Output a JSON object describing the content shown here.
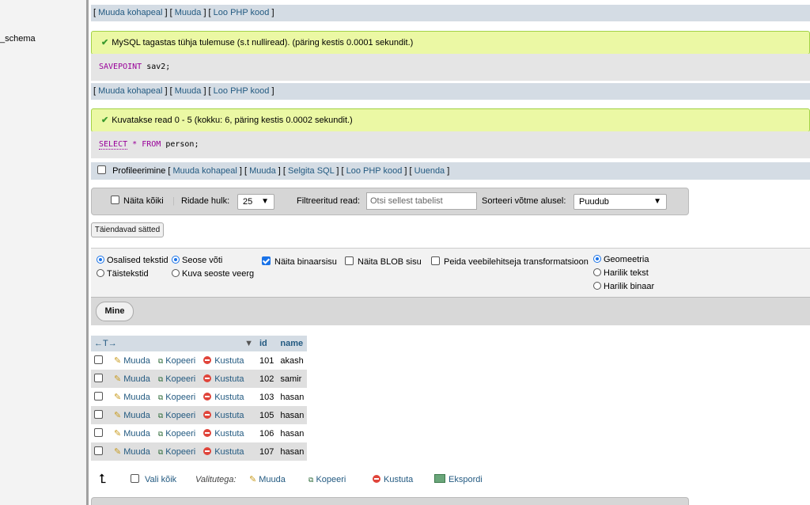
{
  "nav": {
    "items": [
      "",
      "_schema"
    ]
  },
  "top_links": {
    "edit_inline": "Muuda kohapeal",
    "edit": "Muuda",
    "create_php": "Loo PHP kood"
  },
  "message1": "MySQL tagastas tühja tulemuse (s.t nulliread). (päring kestis 0.0001 sekundit.)",
  "sql1": {
    "keyword": "SAVEPOINT",
    "rest": " sav2;"
  },
  "links2": {
    "edit_inline": "Muuda kohapeal",
    "edit": "Muuda",
    "create_php": "Loo PHP kood"
  },
  "message2": "Kuvatakse read 0 - 5 (kokku: 6, päring kestis 0.0002 sekundit.)",
  "sql2": {
    "select": "SELECT",
    "star": "*",
    "from": "FROM",
    "table": " person;"
  },
  "profile_bar": {
    "profiling": "Profileerimine",
    "edit_inline": "Muuda kohapeal",
    "edit": "Muuda",
    "explain": "Selgita SQL",
    "create_php": "Loo PHP kood",
    "refresh": "Uuenda"
  },
  "nav_controls": {
    "show_all": "Näita kõiki",
    "rows_label": "Ridade hulk:",
    "rows_value": "25",
    "filter_label": "Filtreeritud read:",
    "filter_placeholder": "Otsi sellest tabelist",
    "sort_label": "Sorteeri võtme alusel:",
    "sort_value": "Puudub"
  },
  "extra_options_button": "Täiendavad sätted",
  "options": {
    "partial_texts": "Osalised tekstid",
    "full_texts": "Täistekstid",
    "relational_key": "Seose võti",
    "relational_display": "Kuva seoste veerg",
    "show_binary": "Näita binaarsisu",
    "show_blob": "Näita BLOB sisu",
    "hide_transform": "Peida veebilehitseja transformatsioon",
    "geometry": "Geomeetria",
    "wkt": "Harilik tekst",
    "wkb": "Harilik binaar"
  },
  "go_button": "Mine",
  "table": {
    "columns": [
      "id",
      "name"
    ],
    "action_labels": {
      "edit": "Muuda",
      "copy": "Kopeeri",
      "delete": "Kustuta"
    },
    "rows": [
      {
        "id": "101",
        "name": "akash"
      },
      {
        "id": "102",
        "name": "samir"
      },
      {
        "id": "103",
        "name": "hasan"
      },
      {
        "id": "105",
        "name": "hasan"
      },
      {
        "id": "106",
        "name": "hasan"
      },
      {
        "id": "107",
        "name": "hasan"
      }
    ]
  },
  "footer": {
    "select_all": "Vali kõik",
    "with_selected": "Valitutega:",
    "edit": "Muuda",
    "copy": "Kopeeri",
    "delete": "Kustuta",
    "export": "Ekspordi"
  },
  "colors": {
    "link": "#235a81",
    "success_bg": "#ebf8a4",
    "header_bg": "#d4dce4",
    "keyword": "#990099",
    "accent": "#1a73e8"
  }
}
